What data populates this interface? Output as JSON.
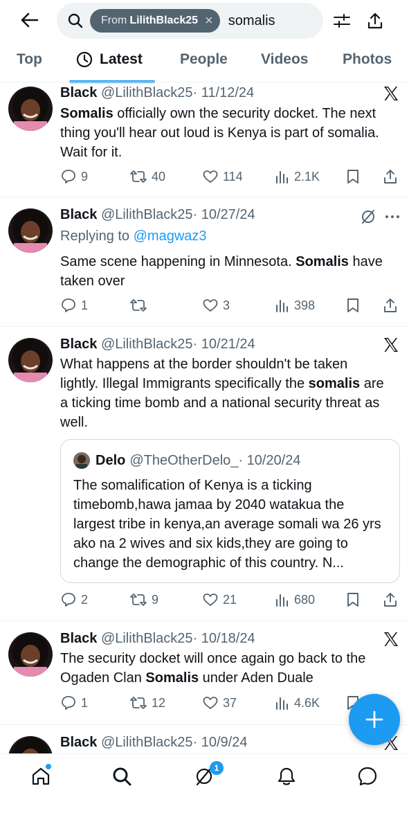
{
  "header": {
    "filter_from": "From",
    "filter_user": "LilithBlack25",
    "query": "somalis"
  },
  "tabs": [
    {
      "label": "Top"
    },
    {
      "label": "Latest"
    },
    {
      "label": "People"
    },
    {
      "label": "Videos"
    },
    {
      "label": "Photos"
    }
  ],
  "tweets": [
    {
      "name": "Black",
      "handle": "@LilithBlack25",
      "date": "· 11/12/24",
      "text_bold": "Somalis",
      "text_rest": " officially own the security docket. The next thing you'll hear out loud is Kenya is part of somalia. Wait for it.",
      "replies": "9",
      "reposts": "40",
      "likes": "114",
      "views": "2.1K"
    },
    {
      "name": "Black",
      "handle": "@LilithBlack25",
      "date": "· 10/27/24",
      "replying_label": "Replying to ",
      "replying_to": "@magwaz3",
      "text_before": "Same scene happening in Minnesota. ",
      "text_bold": "Somalis",
      "text_after": " have taken over",
      "replies": "1",
      "reposts": "",
      "likes": "3",
      "views": "398"
    },
    {
      "name": "Black",
      "handle": "@LilithBlack25",
      "date": "· 10/21/24",
      "text_before": "What happens at the border shouldn't be taken lightly. Illegal Immigrants specifically the ",
      "text_bold": "somalis",
      "text_after": " are a ticking time bomb and a national security threat as well.",
      "quote": {
        "name": "Delo",
        "handle": "@TheOtherDelo_",
        "date": "· 10/20/24",
        "text": "The somalification of Kenya is a ticking timebomb,hawa jamaa by 2040 watakua the largest tribe in kenya,an average somali wa 26 yrs ako na 2 wives and six kids,they are going to change the demographic of this country. N..."
      },
      "replies": "2",
      "reposts": "9",
      "likes": "21",
      "views": "680"
    },
    {
      "name": "Black",
      "handle": "@LilithBlack25",
      "date": "· 10/18/24",
      "text_before": "The security docket will once again go back to the Ogaden Clan ",
      "text_bold": "Somalis",
      "text_after": " under Aden Duale",
      "replies": "1",
      "reposts": "12",
      "likes": "37",
      "views": "4.6K"
    },
    {
      "name": "Black",
      "handle": "@LilithBlack25",
      "date": "· 10/9/24"
    }
  ],
  "nav": {
    "messages_badge": "1"
  },
  "colors": {
    "accent": "#1d9bf0",
    "text": "#0f1419",
    "muted": "#536471"
  }
}
